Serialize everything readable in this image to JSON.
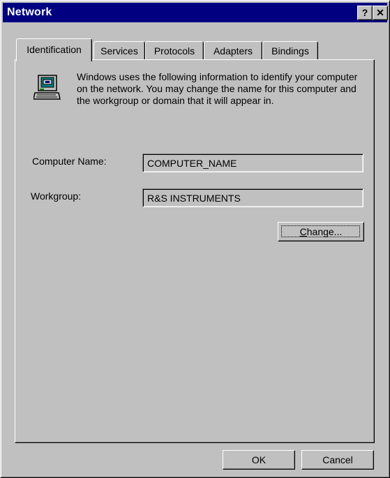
{
  "window": {
    "title": "Network",
    "help_button": "?",
    "close_button": "✕"
  },
  "tabs": [
    {
      "label": "Identification",
      "active": true
    },
    {
      "label": "Services",
      "active": false
    },
    {
      "label": "Protocols",
      "active": false
    },
    {
      "label": "Adapters",
      "active": false
    },
    {
      "label": "Bindings",
      "active": false
    }
  ],
  "identification": {
    "info_text": "Windows uses the following information to identify your computer on the network.  You may change the name for this computer and the workgroup or domain that it will appear in.",
    "computer_name_label": "Computer Name:",
    "computer_name_value": "COMPUTER_NAME",
    "workgroup_label": "Workgroup:",
    "workgroup_value": "R&S INSTRUMENTS",
    "change_button": {
      "mnemonic": "C",
      "rest": "hange..."
    }
  },
  "footer": {
    "ok_label": "OK",
    "cancel_label": "Cancel"
  },
  "icons": {
    "computer": "computer-icon",
    "help": "help-icon",
    "close": "close-icon"
  }
}
